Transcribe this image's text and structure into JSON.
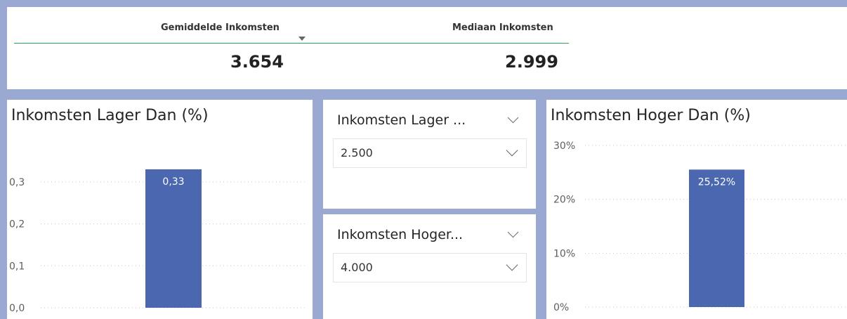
{
  "kpis": {
    "mean_label": "Gemiddelde Inkomsten",
    "mean_value": "3.654",
    "median_label": "Mediaan Inkomsten",
    "median_value": "2.999"
  },
  "slicers": {
    "low": {
      "title": "Inkomsten Lager ...",
      "value": "2.500"
    },
    "high": {
      "title": "Inkomsten Hoger...",
      "value": "4.000"
    }
  },
  "colors": {
    "bar": "#4a67b0",
    "accent_line": "#28a55a",
    "background": "#9aa9d2"
  },
  "icons": {
    "sort": "triangle-down",
    "chevron": "chevron-down"
  },
  "chart_data": [
    {
      "type": "bar",
      "title": "Inkomsten Lager Dan (%)",
      "values": [
        0.33
      ],
      "data_labels": [
        "0,33"
      ],
      "yticks": [
        0.0,
        0.1,
        0.2,
        0.3
      ],
      "ytick_labels": [
        "0,0",
        "0,1",
        "0,2",
        "0,3"
      ],
      "ylim": [
        0,
        0.335
      ],
      "grid": true
    },
    {
      "type": "bar",
      "title": "Inkomsten Hoger Dan (%)",
      "values": [
        25.52
      ],
      "data_labels": [
        "25,52%"
      ],
      "yticks": [
        0,
        10,
        20,
        30
      ],
      "ytick_labels": [
        "0%",
        "10%",
        "20%",
        "30%"
      ],
      "ylim": [
        0,
        30
      ],
      "grid": true
    }
  ]
}
